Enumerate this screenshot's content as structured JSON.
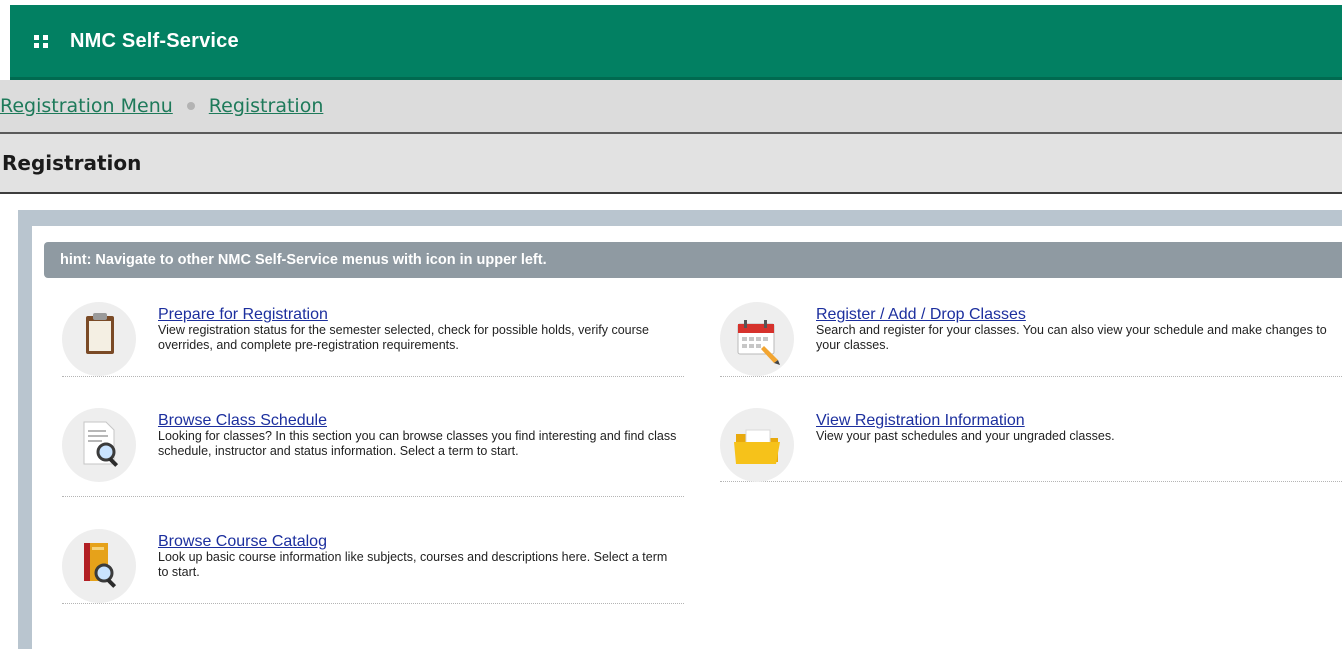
{
  "app": {
    "title": "NMC Self-Service"
  },
  "breadcrumb": {
    "items": [
      "Registration Menu",
      "Registration"
    ]
  },
  "page": {
    "title": "Registration"
  },
  "hint": "hint: Navigate to other NMC Self-Service menus with icon in upper left.",
  "items": [
    {
      "title": "Prepare for Registration",
      "description": "View registration status for the semester selected, check for possible holds, verify course overrides, and complete pre-registration requirements.",
      "icon": "clipboard-icon"
    },
    {
      "title": "Register / Add / Drop Classes",
      "description": "Search and register for your classes. You can also view your schedule and make changes to your classes.",
      "icon": "calendar-edit-icon"
    },
    {
      "title": "Browse Class Schedule",
      "description": "Looking for classes? In this section you can browse classes you find interesting and find class schedule, instructor and status information. Select a term to start.",
      "icon": "document-search-icon"
    },
    {
      "title": "View Registration Information",
      "description": "View your past schedules and your ungraded classes.",
      "icon": "folder-icon"
    },
    {
      "title": "Browse Course Catalog",
      "description": "Look up basic course information like subjects, courses and descriptions here. Select a term to start.",
      "icon": "book-search-icon"
    }
  ],
  "colors": {
    "header": "#028062",
    "link": "#1c2f9e",
    "breadcrumb": "#1e7a5a",
    "hint_bg": "#8f9aa2"
  }
}
